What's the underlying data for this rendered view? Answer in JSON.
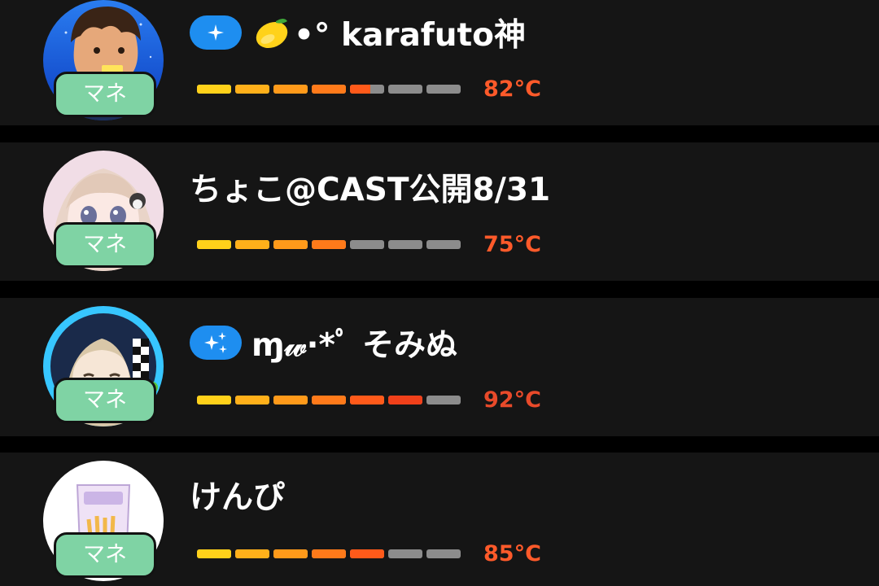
{
  "colors": {
    "background": "#000000",
    "card": "#151515",
    "text": "#ffffff",
    "badge_blue": "#1e8ef0",
    "mane_green": "#7fd3a4",
    "meter_empty": "#8c8c8c",
    "meter_segments": [
      "#ffd11a",
      "#ffb01a",
      "#ff9a1a",
      "#ff7a1a",
      "#ff5a1a",
      "#f0401a",
      "#e02a1a"
    ]
  },
  "users": [
    {
      "name": "•° karafuto神",
      "badge": "sparkle-badge",
      "emoji": "lemon",
      "tag": "マネ",
      "temperature_label": "82°C",
      "temperature": 82,
      "meter_level": 4.6,
      "temp_color": "#ff5a2a",
      "avatar": "boy-avatar"
    },
    {
      "name": "ちょこ@CAST公開8/31",
      "badge": null,
      "emoji": null,
      "tag": "マネ",
      "temperature_label": "75°C",
      "temperature": 75,
      "meter_level": 4,
      "temp_color": "#ff5a2a",
      "avatar": "pastel-girl-avatar"
    },
    {
      "name": "ɱ𝓌·*ﾟ そみぬ",
      "badge": "triple-sparkle-badge",
      "emoji": null,
      "tag": "マネ",
      "temperature_label": "92°C",
      "temperature": 92,
      "meter_level": 6,
      "temp_color": "#e84a2a",
      "avatar": "checker-girl-avatar"
    },
    {
      "name": "けんぴ",
      "badge": null,
      "emoji": null,
      "tag": "マネ",
      "temperature_label": "85°C",
      "temperature": 85,
      "meter_level": 5,
      "temp_color": "#ff5a2a",
      "avatar": "snack-bag-avatar"
    }
  ]
}
